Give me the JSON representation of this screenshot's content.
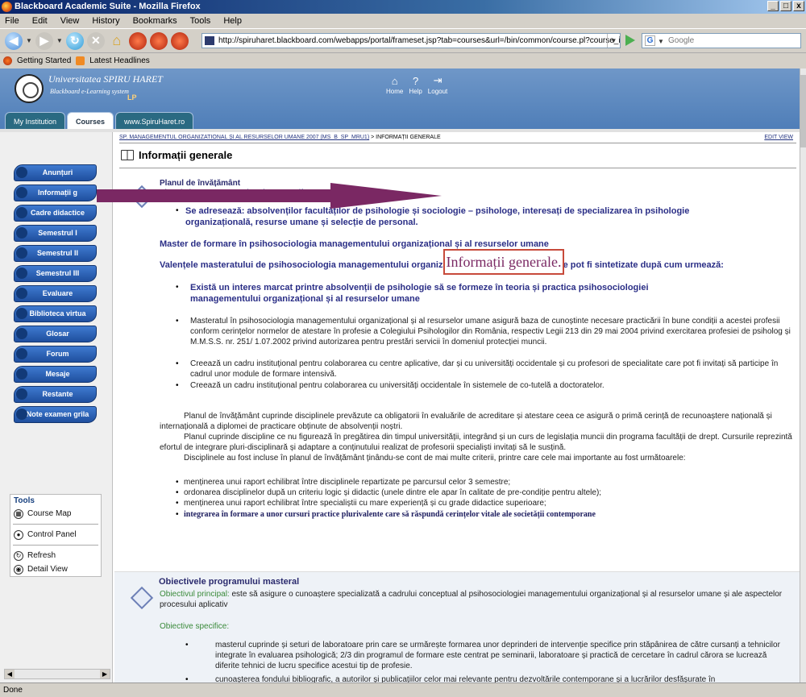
{
  "window": {
    "title": "Blackboard Academic Suite - Mozilla Firefox",
    "min": "_",
    "max": "□",
    "close": "x"
  },
  "menu": [
    "File",
    "Edit",
    "View",
    "History",
    "Bookmarks",
    "Tools",
    "Help"
  ],
  "address": {
    "url": "http://spiruharet.blackboard.com/webapps/portal/frameset.jsp?tab=courses&url=/bin/common/course.pl?course_id=_1659_1"
  },
  "search": {
    "placeholder": "Google"
  },
  "bookmarks": [
    "Getting Started",
    "Latest Headlines"
  ],
  "header": {
    "uni_name": "Universitatea SPIRU HARET",
    "uni_sub": "Blackboard e-Learning system",
    "lp": "LP",
    "nav": [
      "Home",
      "Help",
      "Logout"
    ],
    "tabs": [
      "My Institution",
      "Courses",
      "www.SpiruHaret.ro"
    ]
  },
  "sidebar": {
    "items": [
      "Anunțuri",
      "Informații g",
      "Cadre didactice",
      "Semestrul I",
      "Semestrul II",
      "Semestrul III",
      "Evaluare",
      "Biblioteca virtua",
      "Glosar",
      "Forum",
      "Mesaje",
      "Restante",
      "Note examen grila"
    ],
    "tools_title": "Tools",
    "tools": [
      "Course Map",
      "Control Panel",
      "Refresh",
      "Detail View"
    ]
  },
  "content": {
    "breadcrumb_link": "SP. MANAGEMENTUL ORGANIZATIONAL ȘI AL RESURSELOR UMANE 2007 (MS_B_SP_MRU1)",
    "breadcrumb_sep": " > ",
    "breadcrumb_current": "INFORMAȚII GENERALE",
    "edit_view": "EDIT VIEW",
    "title": "Informații generale",
    "annotation": "Informații generale.",
    "plan_title": "Planul de învățământ",
    "plan_link": "Plan de invatamant aprobat de MEC.pdf",
    "plan_size": "(119,865 Kb)",
    "adreseaza": "Se adresează: absolvenților facultăților de psihologie și sociologie – psihologe, interesați de specializarea în psihologie organizațională, resurse umane și selecție de personal.",
    "master": "Master de formare în psihosociologia managementului organizațional și al resurselor umane",
    "valente": "Valențele masteratului de psihosociologia managementului organizațional și al resurselor umane pot fi sintetizate după cum urmează:",
    "interes": "Există un interes marcat printre absolvenții de psihologie să se formeze în teoria și practica psihosociologiei managementului organizațional și al resurselor umane",
    "b1": "Masteratul în psihosociologia managementului organizațional și al resurselor umane asigură baza de cunoștinte necesare practicării în bune condiții a acestei profesii conform cerințelor normelor de atestare în profesie a Colegiului Psihologilor din România, respectiv Legii 213 din 29 mai 2004 privind exercitarea profesiei de psiholog și M.M.S.S. nr. 251/ 1.07.2002 privind autorizarea pentru prestări servicii în domeniul protecției muncii.",
    "b2": "Creează un cadru instituțional pentru colaborarea cu centre aplicative, dar și cu universități occidentale și cu profesori de specialitate care pot fi invitați să participe în cadrul unor module de formare intensivă.",
    "b3": "Creează un cadru instituțional pentru colaborarea cu universități occidentale în sistemele de co-tutelă a doctoratelor.",
    "p1": "Planul de învățământ cuprinde disciplinele prevăzute ca obligatorii în evaluările de acreditare și atestare ceea ce asigură o primă cerință de recunoaștere națională și internațională a diplomei de practicare obținute de absolvenții noștri.",
    "p2": "Planul cuprinde discipline ce nu figurează în pregătirea din timpul universității, integrând și un curs de legislația muncii din programa facultății de drept. Cursurile reprezintă efortul de integrare pluri-disciplinară și adaptare a conținutului realizat de profesorii specialiști invitați să le susțină.",
    "p3": "Disciplinele au fost incluse în planul de învățământ ținându-se cont de mai multe criterii, printre care cele mai importante au fost următoarele:",
    "c1": "menținerea unui raport echilibrat între disciplinele repartizate pe parcursul celor 3 semestre;",
    "c2": "ordonarea disciplinelor după un criteriu logic și didactic (unele dintre ele apar în calitate de pre-condiție pentru altele);",
    "c3": "menținerea unui raport echilibrat între specialiștii cu mare experiență și cu grade didactice superioare;",
    "c4": "integrarea în formare a unor cursuri practice plurivalente care să răspundă cerințelor vitale ale societății contemporane",
    "obj_title": "Obiectivele programului masteral",
    "obj_principal_label": "Obiectivul principal:",
    "obj_principal": " este să asigure o cunoaștere specializată a cadrului conceptual al psihosociologiei managementului organizațional și al resurselor umane și ale aspectelor procesului aplicativ",
    "obj_spec": "Obiective specifice:",
    "s1": "masterul cuprinde și seturi de laboratoare prin care se urmărește formarea unor deprinderi de intervenție specifice prin stăpânirea de către cursanți a tehnicilor integrate în evaluarea psihologică; 2/3 din programul de formare este centrat pe seminarii, laboratoare și practică de cercetare în cadrul cărora se lucrează diferite tehnici de lucru specifice acestui tip de profesie.",
    "s2": "cunoașterea fondului bibliografic, a autorilor și publicațiilor celor mai relevante pentru dezvoltările contemporane și a lucrărilor desfășurate în"
  },
  "status": "Done"
}
